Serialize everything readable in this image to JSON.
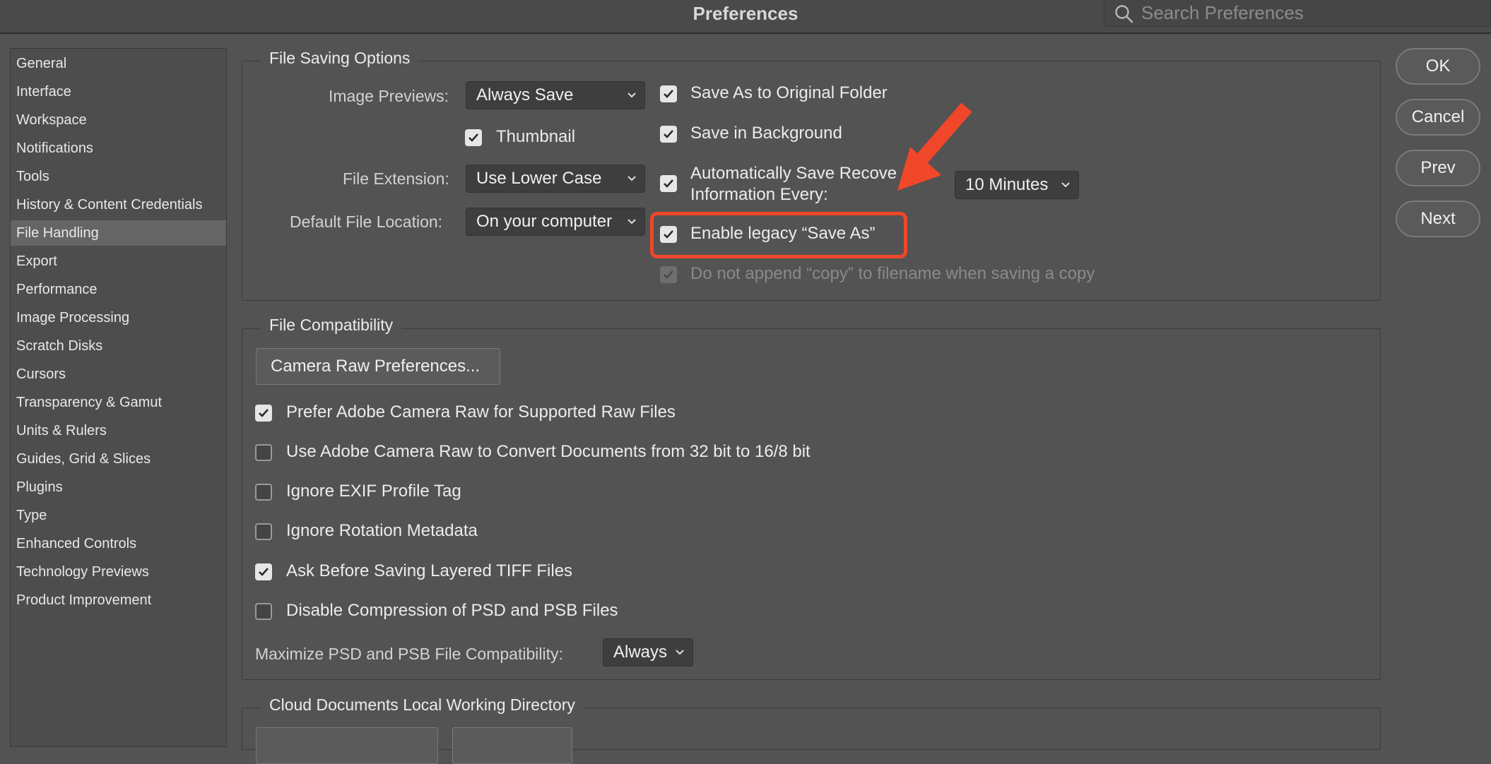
{
  "window": {
    "title": "Preferences"
  },
  "search": {
    "placeholder": "Search Preferences"
  },
  "sidebar": {
    "items": [
      {
        "label": "General"
      },
      {
        "label": "Interface"
      },
      {
        "label": "Workspace"
      },
      {
        "label": "Notifications"
      },
      {
        "label": "Tools"
      },
      {
        "label": "History & Content Credentials"
      },
      {
        "label": "File Handling",
        "active": true
      },
      {
        "label": "Export"
      },
      {
        "label": "Performance"
      },
      {
        "label": "Image Processing"
      },
      {
        "label": "Scratch Disks"
      },
      {
        "label": "Cursors"
      },
      {
        "label": "Transparency & Gamut"
      },
      {
        "label": "Units & Rulers"
      },
      {
        "label": "Guides, Grid & Slices"
      },
      {
        "label": "Plugins"
      },
      {
        "label": "Type"
      },
      {
        "label": "Enhanced Controls"
      },
      {
        "label": "Technology Previews"
      },
      {
        "label": "Product Improvement"
      }
    ]
  },
  "buttons": {
    "ok": "OK",
    "cancel": "Cancel",
    "prev": "Prev",
    "next": "Next"
  },
  "file_saving": {
    "title": "File Saving Options",
    "image_previews_label": "Image Previews:",
    "image_previews_value": "Always Save",
    "thumbnail_label": "Thumbnail",
    "thumbnail_checked": true,
    "file_extension_label": "File Extension:",
    "file_extension_value": "Use Lower Case",
    "default_location_label": "Default File Location:",
    "default_location_value": "On your computer",
    "save_as_original_folder": "Save As to Original Folder",
    "save_in_background": "Save in Background",
    "auto_save_line1": "Automatically Save Recove",
    "auto_save_line2": "Information Every:",
    "auto_save_interval": "10 Minutes",
    "enable_legacy_save_as": "Enable legacy “Save As”",
    "do_not_append_copy": "Do not append “copy” to filename when saving a copy"
  },
  "file_compat": {
    "title": "File Compatibility",
    "camera_raw_prefs": "Camera Raw Preferences...",
    "options": [
      {
        "label": "Prefer Adobe Camera Raw for Supported Raw Files",
        "checked": true
      },
      {
        "label": "Use Adobe Camera Raw to Convert Documents from 32 bit to 16/8 bit",
        "checked": false
      },
      {
        "label": "Ignore EXIF Profile Tag",
        "checked": false
      },
      {
        "label": "Ignore Rotation Metadata",
        "checked": false
      },
      {
        "label": "Ask Before Saving Layered TIFF Files",
        "checked": true
      },
      {
        "label": "Disable Compression of PSD and PSB Files",
        "checked": false
      }
    ],
    "maximize_label": "Maximize PSD and PSB File Compatibility:",
    "maximize_value": "Always"
  },
  "cloud_docs": {
    "title": "Cloud Documents Local Working Directory"
  },
  "annotation": {
    "highlight_color": "#f0462a"
  }
}
